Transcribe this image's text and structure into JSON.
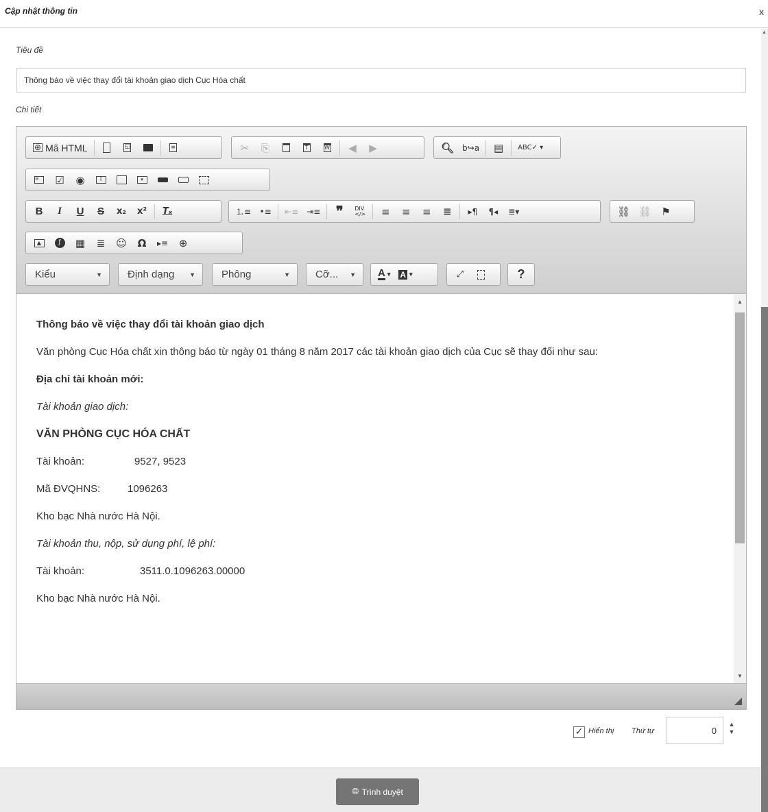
{
  "dialog": {
    "title": "Cập nhật thông tin",
    "close": "x"
  },
  "form": {
    "title_label": "Tiêu đề",
    "title_value": "Thông báo về việc thay đổi tài khoản giao dịch Cục Hóa chất",
    "detail_label": "Chi tiết"
  },
  "toolbar": {
    "source_label": "Mã HTML",
    "source_icon": "⊕",
    "combos": {
      "style": "Kiểu",
      "format": "Định dạng",
      "font": "Phông",
      "size": "Cỡ..."
    },
    "glyphs": {
      "newpage": "🗋",
      "preview": "🔍",
      "print": "🖶",
      "templates": "🗎",
      "cut": "✂",
      "copy": "⎘",
      "paste": "📋",
      "paste_text": "📋",
      "paste_word": "📋",
      "undo": "↶",
      "redo": "↷",
      "find": "🔍",
      "replace": "⇄",
      "selectall": "▤",
      "spell": "ABC",
      "form": "▤",
      "checkbox": "☑",
      "radio": "◉",
      "textfield": "⌶",
      "textarea": "▭",
      "select": "▾",
      "button": "▬",
      "imagebutton": "▭",
      "hiddenfield": "⬚",
      "bold": "B",
      "italic": "I",
      "underline": "U",
      "strike": "S",
      "subscript": "x₂",
      "superscript": "x²",
      "removeformat": "Tx",
      "numlist": "1≡",
      "bulletlist": "•≡",
      "outdent": "⇤",
      "indent": "⇥",
      "blockquote": "❞",
      "div": "DIV",
      "align_left": "≡",
      "align_center": "≡",
      "align_right": "≡",
      "justify": "≡",
      "ltr": "¶",
      "rtl": "¶",
      "language": "≡",
      "link": "⛓",
      "unlink": "⛓",
      "anchor": "⚑",
      "image": "🖼",
      "flash": "◆",
      "table": "▦",
      "hline": "≣",
      "smiley": "☺",
      "specialchar": "Ω",
      "pagebreak": "⇥",
      "iframe": "⊕",
      "textcolor": "A",
      "bgcolor": "A",
      "maximize": "⤢",
      "showblocks": "▯",
      "about": "?"
    }
  },
  "content": {
    "heading": "Thông báo về việc thay đổi tài khoản giao dịch",
    "intro": "Văn phòng Cục Hóa chất xin thông báo từ ngày 01 tháng 8 năm 2017 các tài khoản giao dịch của Cục sẽ thay đổi như sau:",
    "new_address_label": "Địa chỉ tài khoản mới:",
    "trans_account_label": "Tài khoản giao dịch:",
    "office_name": "VĂN PHÒNG CỤC HÓA CHẤT",
    "account_label": "Tài khoản:",
    "account_value": "9527, 9523",
    "dvqhns_label": "Mã ĐVQHNS:",
    "dvqhns_value": "1096263",
    "treasury_1": "Kho bạc Nhà nước Hà Nội.",
    "fee_account_label": "Tài khoản thu, nộp, sử dụng phí, lệ phí:",
    "account2_label": "Tài khoản:",
    "account2_value": "3511.0.1096263.00000",
    "treasury_2": "Kho bạc Nhà nước Hà Nội."
  },
  "options": {
    "show_label": "Hiển thị",
    "show_checked": true,
    "order_label": "Thứ tự",
    "order_value": "0"
  },
  "footer": {
    "browse_label": "Trình duyệt"
  }
}
